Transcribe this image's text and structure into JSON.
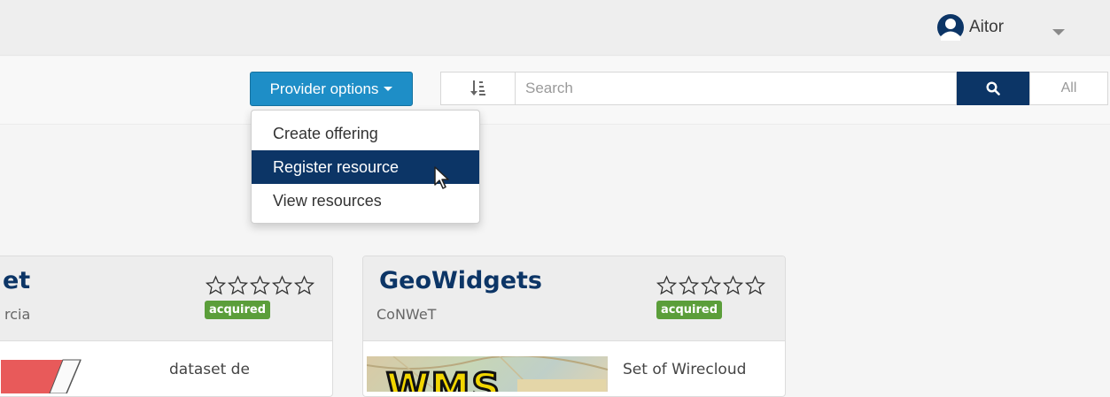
{
  "header": {
    "user_name": "Aitor"
  },
  "toolbar": {
    "provider_button_label": "Provider options",
    "search_placeholder": "Search",
    "all_label": "All"
  },
  "dropdown": {
    "items": [
      {
        "label": "Create offering"
      },
      {
        "label": "Register resource"
      },
      {
        "label": "View resources"
      }
    ],
    "active_index": 1
  },
  "cards": [
    {
      "title": "et",
      "subtitle": "rcia",
      "badge": "acquired",
      "description": "dataset de",
      "rating": 0
    },
    {
      "title": "GeoWidgets",
      "subtitle": "CoNWeT",
      "badge": "acquired",
      "description": "Set of Wirecloud",
      "thumbnail_text": "WMS",
      "rating": 0
    }
  ],
  "colors": {
    "accent": "#1e8ec7",
    "navy": "#0c3566",
    "badge": "#5b9e3a"
  }
}
